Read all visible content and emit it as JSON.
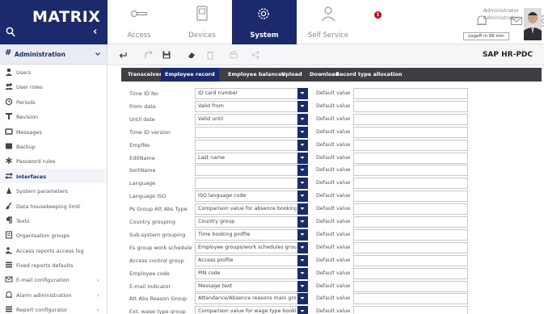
{
  "brand": {
    "title": "MATRIX",
    "collapse_glyph": "‹",
    "search_icon": "search-icon"
  },
  "topnav": {
    "items": [
      {
        "label": "Access",
        "icon": "key-icon"
      },
      {
        "label": "Devices",
        "icon": "device-icon"
      },
      {
        "label": "System",
        "icon": "gear-icon"
      },
      {
        "label": "Self Service",
        "icon": "person-icon"
      }
    ],
    "active": "System",
    "notification_count": "1"
  },
  "user": {
    "line1": "Administrator",
    "line2": "Administrator",
    "logoff_label": "Logoff in 99 min"
  },
  "sidebar": {
    "section_label": "Administration",
    "items": [
      {
        "label": "Users",
        "icon": "user-icon",
        "chevron": ""
      },
      {
        "label": "User roles",
        "icon": "users-icon",
        "chevron": ""
      },
      {
        "label": "Periods",
        "icon": "history-icon",
        "chevron": ""
      },
      {
        "label": "Revision",
        "icon": "revision-icon",
        "chevron": ""
      },
      {
        "label": "Messages",
        "icon": "message-icon",
        "chevron": ""
      },
      {
        "label": "Backup",
        "icon": "backup-icon",
        "chevron": ""
      },
      {
        "label": "Password rules",
        "icon": "asterisk-icon",
        "chevron": ""
      },
      {
        "label": "Interfaces",
        "icon": "interfaces-icon",
        "chevron": ""
      },
      {
        "label": "System parameters",
        "icon": "parameters-icon",
        "chevron": ""
      },
      {
        "label": "Data housekeeping limit",
        "icon": "broom-icon",
        "chevron": ""
      },
      {
        "label": "Texts",
        "icon": "paragraph-icon",
        "chevron": ""
      },
      {
        "label": "Organisation groups",
        "icon": "organisation-icon",
        "chevron": ""
      },
      {
        "label": "Access reports access log",
        "icon": "report-user-icon",
        "chevron": ""
      },
      {
        "label": "Fixed reports defaults",
        "icon": "list-icon",
        "chevron": ""
      },
      {
        "label": "E-mail configuration",
        "icon": "envelope-icon",
        "chevron": "›"
      },
      {
        "label": "Alarm administration",
        "icon": "bell-icon",
        "chevron": "›"
      },
      {
        "label": "Report configurator",
        "icon": "list-icon",
        "chevron": "›"
      }
    ],
    "active": "Interfaces"
  },
  "toolbar": {
    "title": "SAP HR-PDC"
  },
  "tabs": {
    "items": [
      "Transceiver",
      "Employee record",
      "Employee balances",
      "Upload",
      "Download",
      "Record type allocation"
    ],
    "active": "Employee record"
  },
  "form": {
    "default_label": "Default value",
    "rows": [
      {
        "label": "Time ID No",
        "value": "ID card number",
        "default": ""
      },
      {
        "label": "From date",
        "value": "Valid from",
        "default": ""
      },
      {
        "label": "Until date",
        "value": "Valid until",
        "default": ""
      },
      {
        "label": "Time ID version",
        "value": "",
        "default": ""
      },
      {
        "label": "EmplNo",
        "value": "",
        "default": ""
      },
      {
        "label": "EditName",
        "value": "Last name",
        "default": ""
      },
      {
        "label": "SortName",
        "value": "",
        "default": ""
      },
      {
        "label": "Language",
        "value": "",
        "default": ""
      },
      {
        "label": "Language ISO",
        "value": "ISO language code",
        "default": ""
      },
      {
        "label": "Ps Group Att Abs Type",
        "value": "Comparison value for absence booking",
        "default": ""
      },
      {
        "label": "Country grouping",
        "value": "Country group",
        "default": ""
      },
      {
        "label": "Sub-system grouping",
        "value": "Time booking profile",
        "default": ""
      },
      {
        "label": "Es group work schedule",
        "value": "Employee groups/work schedules group",
        "default": ""
      },
      {
        "label": "Access control group",
        "value": "Access profile",
        "default": ""
      },
      {
        "label": "Employee code",
        "value": "PIN code",
        "default": ""
      },
      {
        "label": "E-mail indicator",
        "value": "Message text",
        "default": ""
      },
      {
        "label": "Att Abs Reason Group",
        "value": "Attendance/Absence reasons main group",
        "default": ""
      },
      {
        "label": "Ext. wage type group",
        "value": "Comparison value for wage type booking",
        "default": ""
      }
    ]
  },
  "colors": {
    "navy": "#1a2a6c",
    "tabbar": "#3d3f44",
    "badge": "#d0021b"
  }
}
